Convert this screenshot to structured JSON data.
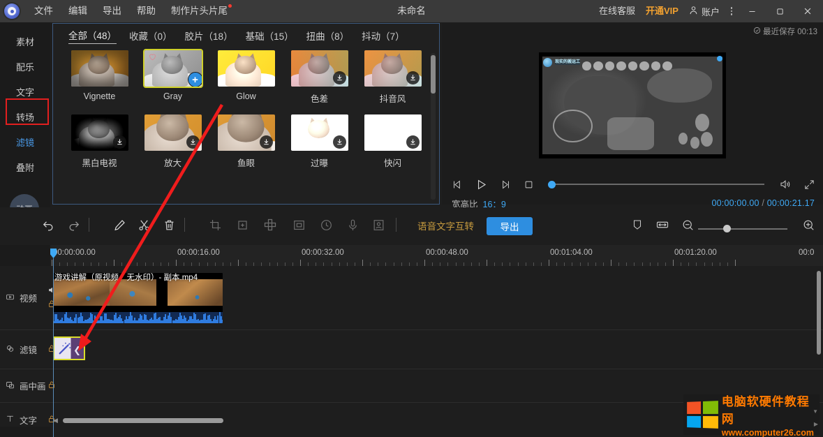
{
  "app": {
    "logo_icon": "app-logo-icon",
    "window_title": "未命名",
    "menus": [
      "文件",
      "编辑",
      "导出",
      "帮助",
      "制作片头片尾"
    ],
    "right": {
      "support": "在线客服",
      "vip": "开通VIP",
      "account": "账户",
      "more_icon": "more-vertical-icon",
      "minimize_icon": "minimize-icon",
      "maximize_icon": "maximize-icon",
      "close_icon": "close-icon"
    }
  },
  "sidebar": {
    "items": [
      {
        "label": "素材",
        "active": false
      },
      {
        "label": "配乐",
        "active": false
      },
      {
        "label": "文字",
        "active": false
      },
      {
        "label": "转场",
        "active": false
      },
      {
        "label": "滤镜",
        "active": true
      },
      {
        "label": "叠附",
        "active": false
      },
      {
        "label": "动画",
        "active": false
      }
    ],
    "highlight_color": "#e21f1f",
    "active_color": "#4a9ae8"
  },
  "filter_panel": {
    "tabs": [
      {
        "label": "全部（48）",
        "active": true
      },
      {
        "label": "收藏（0）",
        "active": false
      },
      {
        "label": "胶片（18）",
        "active": false
      },
      {
        "label": "基础（15）",
        "active": false
      },
      {
        "label": "扭曲（8）",
        "active": false
      },
      {
        "label": "抖动（7）",
        "active": false
      }
    ],
    "items": [
      {
        "label": "Vignette",
        "state": "installed",
        "selected": false
      },
      {
        "label": "Gray",
        "state": "selected",
        "selected": true,
        "favorite": false
      },
      {
        "label": "Glow",
        "state": "installed",
        "selected": false
      },
      {
        "label": "色差",
        "state": "download",
        "selected": false
      },
      {
        "label": "抖音风",
        "state": "download",
        "selected": false
      },
      {
        "label": "黑白电视",
        "state": "download",
        "selected": false
      },
      {
        "label": "放大",
        "state": "download",
        "selected": false
      },
      {
        "label": "鱼眼",
        "state": "download",
        "selected": false
      },
      {
        "label": "过曝",
        "state": "download",
        "selected": false
      },
      {
        "label": "快闪",
        "state": "download",
        "selected": false
      }
    ],
    "selected_border_color": "#cfd12a"
  },
  "preview": {
    "save_status": "最近保存 00:13",
    "save_icon": "check-circle-icon",
    "overlay_badge": "现实的搬运工",
    "controls": [
      {
        "icon": "prev-frame-icon",
        "name": "prev-frame-button"
      },
      {
        "icon": "play-icon",
        "name": "play-button"
      },
      {
        "icon": "next-frame-icon",
        "name": "next-frame-button"
      },
      {
        "icon": "stop-icon",
        "name": "stop-button"
      }
    ],
    "volume_icon": "volume-icon",
    "fullscreen_icon": "fullscreen-icon",
    "ratio_label": "宽高比",
    "ratio_value": "16：9",
    "current_time": "00:00:00.00",
    "total_time": "00:00:21.17",
    "time_sep": "/",
    "accent_color": "#3fa9f5"
  },
  "toolbar": {
    "buttons": [
      {
        "icon": "undo-icon",
        "name": "undo-button",
        "enabled": true
      },
      {
        "icon": "redo-icon",
        "name": "redo-button",
        "enabled": true
      },
      {
        "icon": "pencil-icon",
        "name": "edit-button",
        "enabled": true
      },
      {
        "icon": "scissors-icon",
        "name": "split-button",
        "enabled": true
      },
      {
        "icon": "trash-icon",
        "name": "delete-button",
        "enabled": true
      },
      {
        "icon": "crop-icon",
        "name": "crop-button",
        "enabled": false
      },
      {
        "icon": "keyframe-icon",
        "name": "keyframe-button",
        "enabled": false
      },
      {
        "icon": "mosaic-icon",
        "name": "mosaic-button",
        "enabled": false
      },
      {
        "icon": "pip-icon",
        "name": "pip-button",
        "enabled": false
      },
      {
        "icon": "clock-icon",
        "name": "speed-button",
        "enabled": false
      },
      {
        "icon": "microphone-icon",
        "name": "record-button",
        "enabled": false
      },
      {
        "icon": "person-frame-icon",
        "name": "cutout-button",
        "enabled": false
      }
    ],
    "voice_text_label": "语音文字互转",
    "export_label": "导出",
    "export_color": "#2e8ee0",
    "voice_text_color": "#c69a3e",
    "right_buttons": [
      {
        "icon": "marker-icon",
        "name": "marker-button"
      },
      {
        "icon": "fit-width-icon",
        "name": "fit-timeline-button"
      },
      {
        "icon": "zoom-out-icon",
        "name": "zoom-out-button"
      }
    ],
    "zoom_in_icon": "zoom-in-icon"
  },
  "timeline": {
    "ruler_labels": [
      "00:00:00.00",
      "00:00:16.00",
      "00:00:32.00",
      "00:00:48.00",
      "00:01:04.00",
      "00:01:20.00",
      "00:0"
    ],
    "tracks": [
      {
        "name": "视频",
        "icon": "video-track-icon",
        "mute_icon": "speaker-icon",
        "lock_icon": "unlock-icon"
      },
      {
        "name": "滤镜",
        "icon": "filter-track-icon",
        "lock_icon": "unlock-icon"
      },
      {
        "name": "画中画",
        "icon": "pip-track-icon",
        "lock_icon": "unlock-icon"
      },
      {
        "name": "文字",
        "icon": "text-track-icon",
        "lock_icon": "unlock-icon"
      }
    ],
    "video_clip": {
      "title": "游戏讲解（原视频、无水印）- 副本.mp4"
    },
    "filter_clip": {
      "icon": "magic-wand-icon",
      "selected": true,
      "border_color": "#d9dc2a"
    }
  },
  "watermark": {
    "site_name": "电脑软硬件教程网",
    "url": "www.computer26.com",
    "logo_icon": "windows-logo-icon",
    "color": "#ff7a00"
  }
}
